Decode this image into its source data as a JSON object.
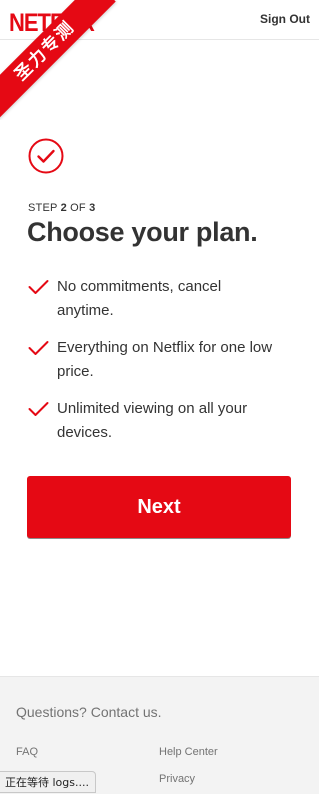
{
  "header": {
    "logo_text": "NETFLIX",
    "sign_out_label": "Sign Out"
  },
  "ribbon": {
    "text": "圣力专测"
  },
  "main": {
    "step_prefix": "STEP ",
    "step_current": "2",
    "step_of": " OF ",
    "step_total": "3",
    "title": "Choose your plan.",
    "benefits": [
      "No commitments, cancel anytime.",
      "Everything on Netflix for one low price.",
      "Unlimited viewing on all your devices."
    ],
    "next_label": "Next"
  },
  "footer": {
    "contact_label": "Questions? Contact us.",
    "links": {
      "faq": "FAQ",
      "help_center": "Help Center",
      "privacy": "Privacy"
    }
  },
  "status": {
    "text": "正在等待 logs...."
  },
  "colors": {
    "brand_red": "#e50914",
    "text": "#333333",
    "muted": "#737373",
    "footer_bg": "#f3f3f3"
  },
  "icons": {
    "check_circle": "check-circle-icon",
    "benefit_tick": "checkmark-icon"
  }
}
